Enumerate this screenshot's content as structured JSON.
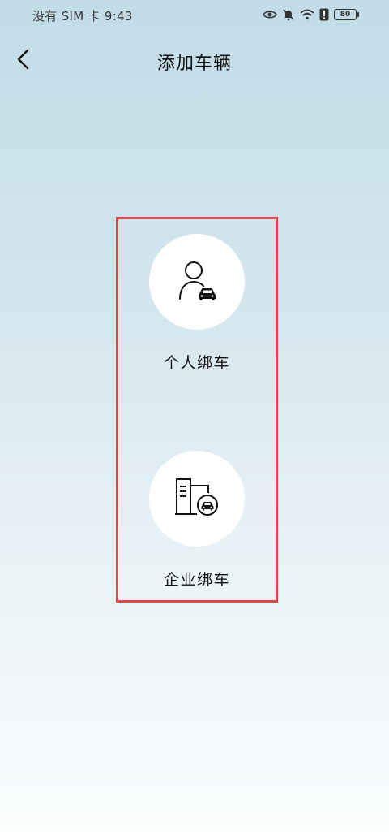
{
  "status_bar": {
    "text": "没有 SIM 卡 9:43",
    "battery": "80",
    "icons": [
      "eye-icon",
      "bell-muted-icon",
      "wifi-icon",
      "alert-icon",
      "battery-icon"
    ]
  },
  "header": {
    "title": "添加车辆",
    "back_icon": "chevron-left-icon"
  },
  "options": [
    {
      "label": "个人绑车",
      "icon": "person-car-icon"
    },
    {
      "label": "企业绑车",
      "icon": "building-car-icon"
    }
  ],
  "colors": {
    "highlight_border": "#e0474c",
    "background_top": "#c2dce8",
    "background_bottom": "#fbfdfe"
  }
}
